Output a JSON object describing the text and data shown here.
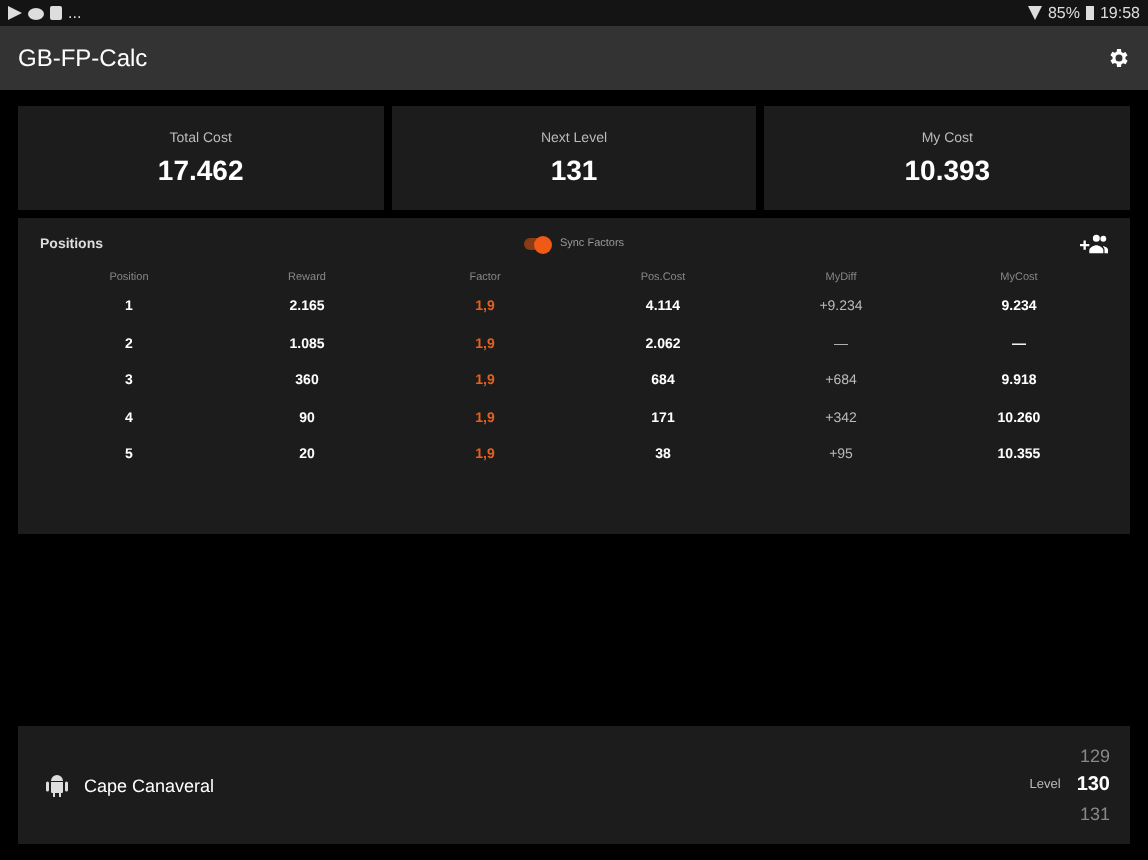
{
  "status_bar": {
    "notifications": "...",
    "battery": "85%",
    "time": "19:58"
  },
  "app_bar": {
    "title": "GB-FP-Calc"
  },
  "stats": [
    {
      "label": "Total Cost",
      "value": "17.462"
    },
    {
      "label": "Next Level",
      "value": "131"
    },
    {
      "label": "My Cost",
      "value": "10.393"
    }
  ],
  "positions": {
    "title": "Positions",
    "sync": {
      "label": "Sync Factors",
      "on": true
    },
    "columns": [
      "Position",
      "Reward",
      "Factor",
      "Pos.Cost",
      "MyDiff",
      "MyCost"
    ],
    "rows": [
      [
        "1",
        "2.165",
        "1,9",
        "4.114",
        "+9.234",
        "9.234"
      ],
      [
        "2",
        "1.085",
        "1,9",
        "2.062",
        "—",
        "—"
      ],
      [
        "3",
        "360",
        "1,9",
        "684",
        "+684",
        "9.918"
      ],
      [
        "4",
        "90",
        "1,9",
        "171",
        "+342",
        "10.260"
      ],
      [
        "5",
        "20",
        "1,9",
        "38",
        "+95",
        "10.355"
      ]
    ]
  },
  "building": {
    "name": "Cape Canaveral",
    "level_label": "Level",
    "levels": [
      {
        "value": "129",
        "selected": false
      },
      {
        "value": "130",
        "selected": true
      },
      {
        "value": "131",
        "selected": false
      }
    ]
  }
}
